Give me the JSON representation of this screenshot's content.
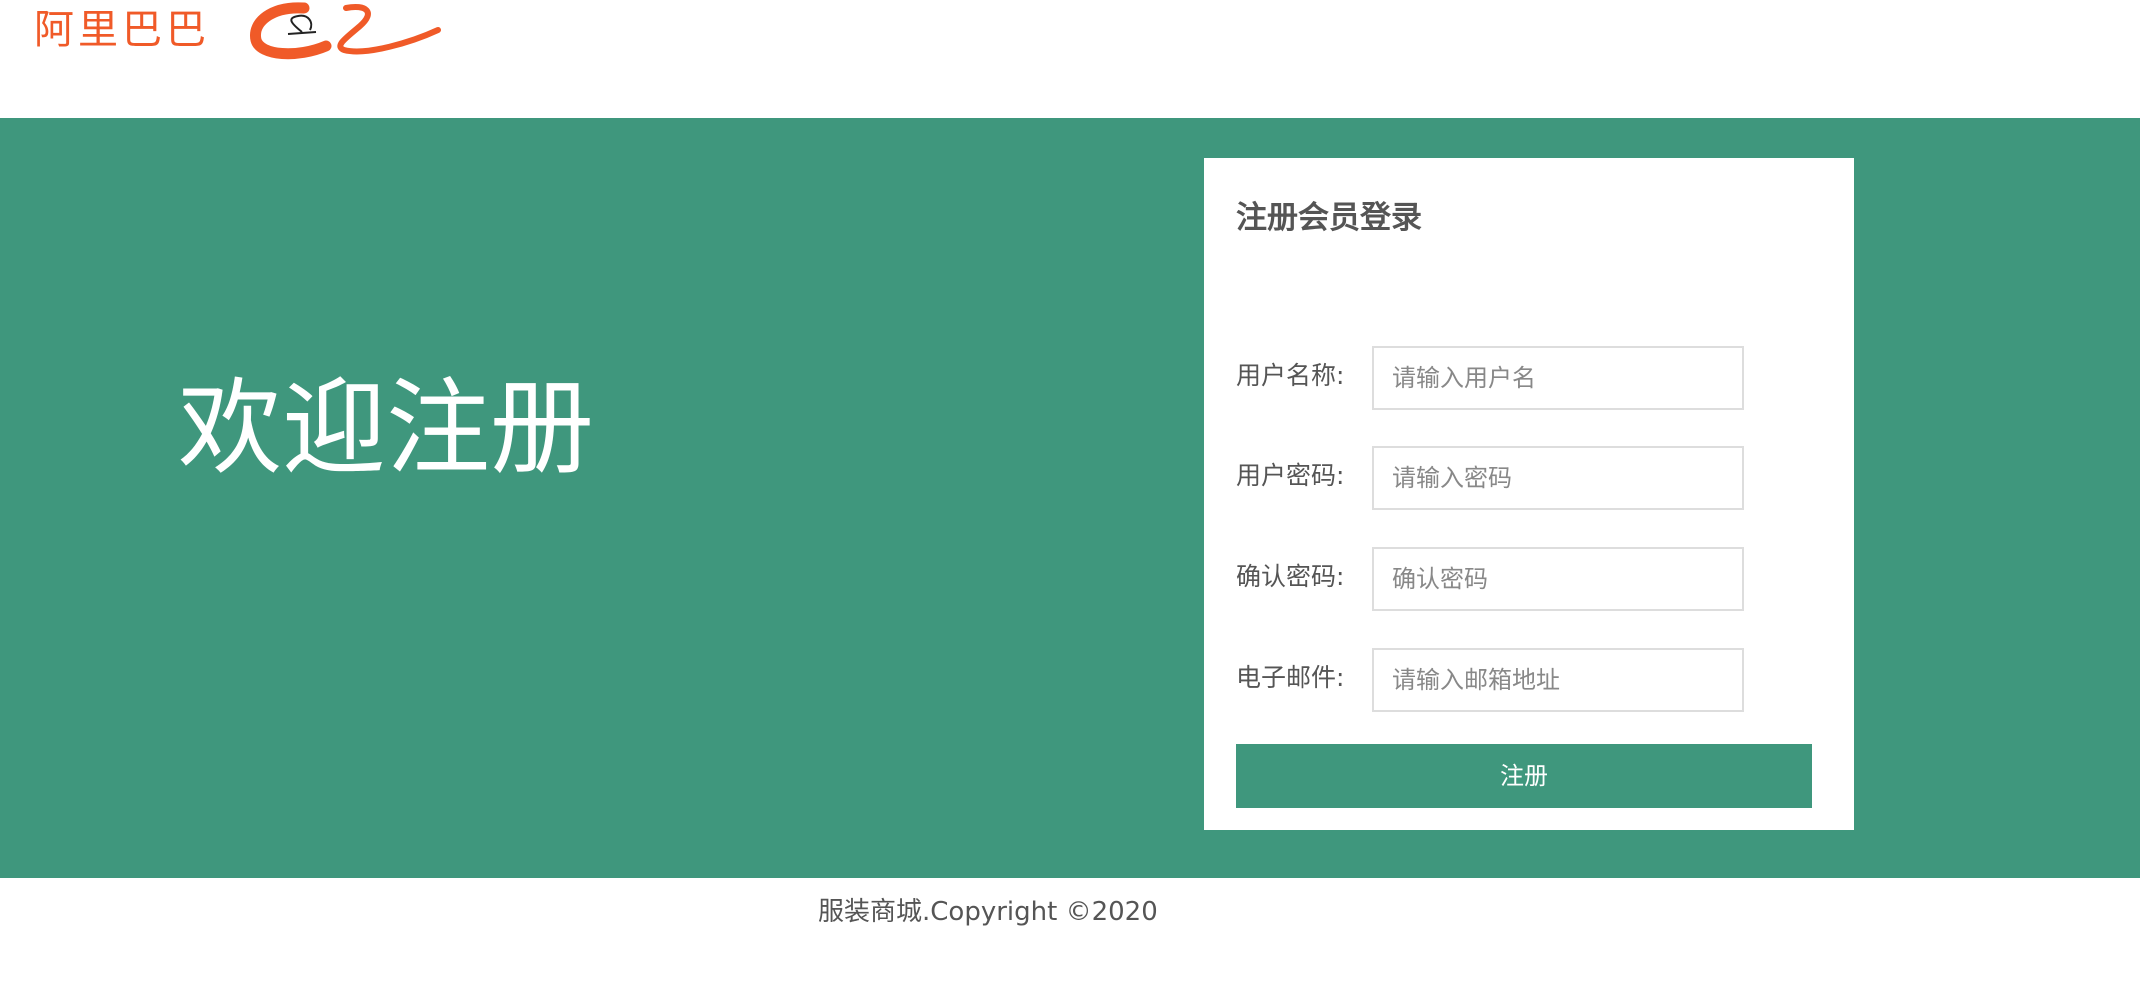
{
  "header": {
    "logo_text": "阿里巴巴",
    "logo_icon": "alibaba-swoosh-logo",
    "brand_color": "#f05a28"
  },
  "banner": {
    "welcome_text": "欢迎注册",
    "background_color": "#3f977d"
  },
  "form": {
    "title": "注册会员登录",
    "fields": [
      {
        "label": "用户名称:",
        "placeholder": "请输入用户名",
        "value": ""
      },
      {
        "label": "用户密码:",
        "placeholder": "请输入密码",
        "value": ""
      },
      {
        "label": "确认密码:",
        "placeholder": "确认密码",
        "value": ""
      },
      {
        "label": "电子邮件:",
        "placeholder": "请输入邮箱地址",
        "value": ""
      }
    ],
    "submit_label": "注册",
    "accent_color": "#3f977d"
  },
  "footer": {
    "copyright": "服装商城.Copyright ©2020"
  }
}
